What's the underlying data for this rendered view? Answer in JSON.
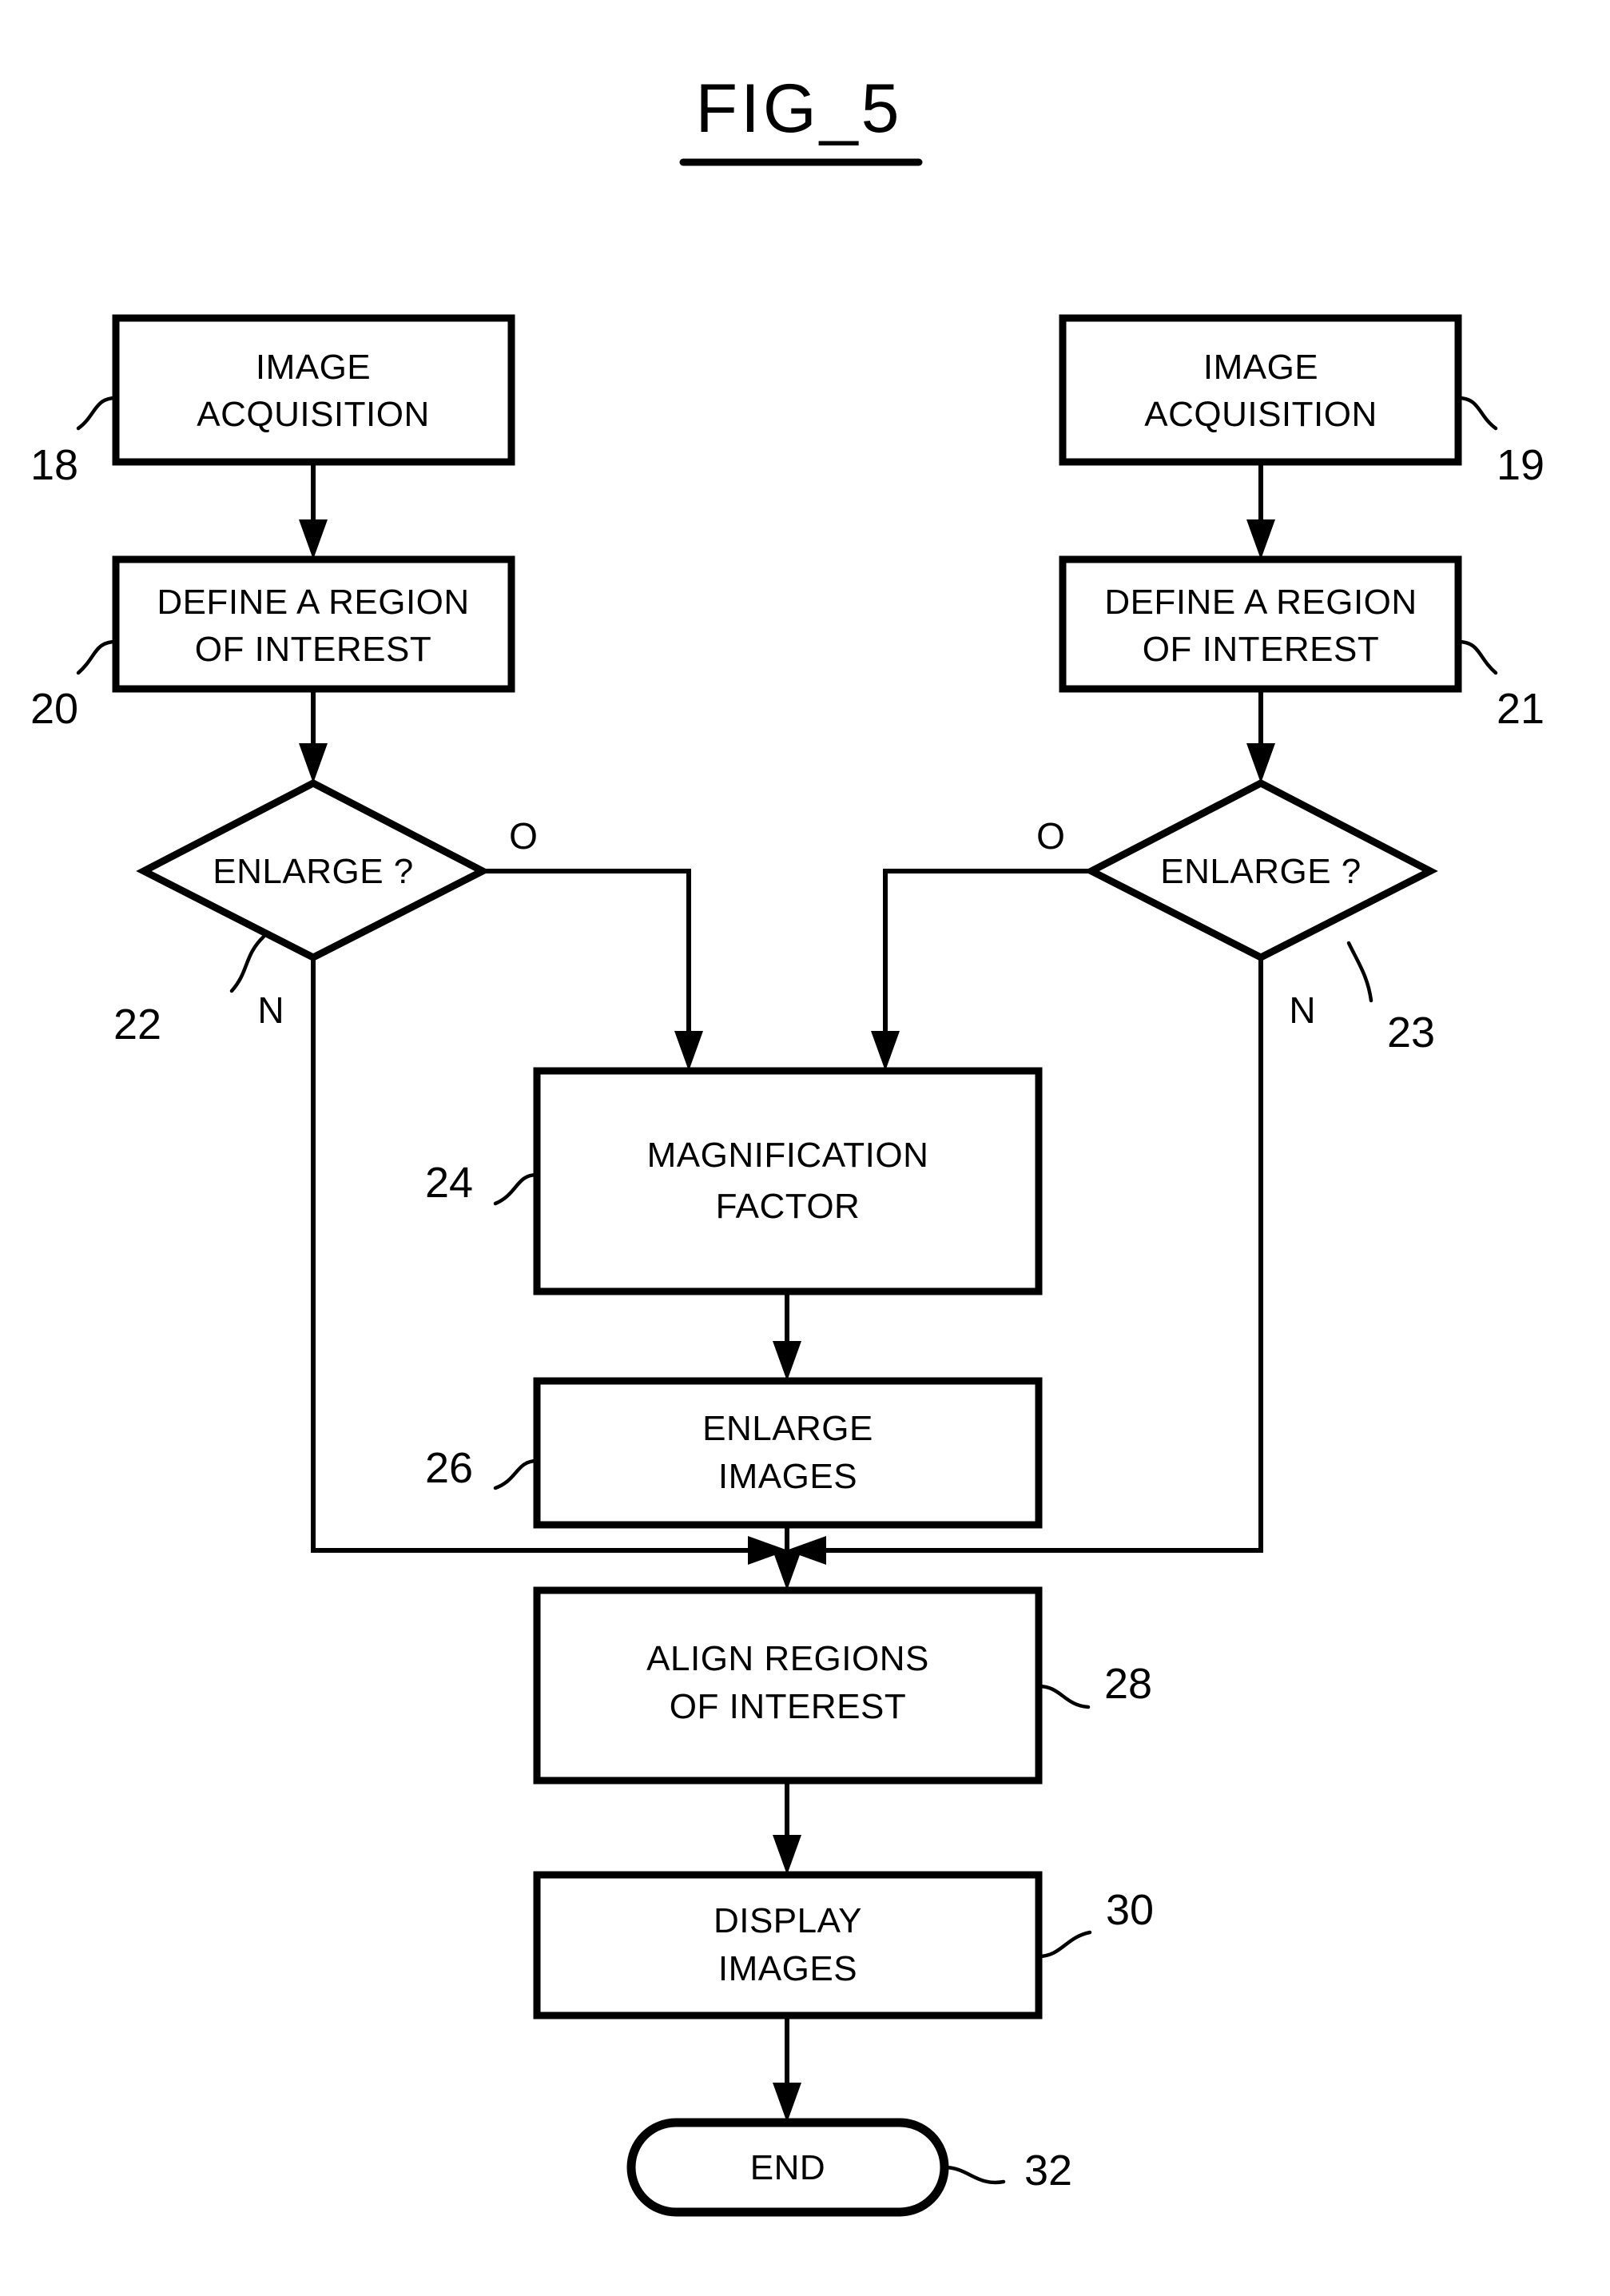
{
  "figure": {
    "title": "FIG_5",
    "type": "patent-flowchart"
  },
  "nodes": {
    "n18": {
      "ref": "18",
      "line1": "IMAGE",
      "line2": "ACQUISITION",
      "shape": "process"
    },
    "n19": {
      "ref": "19",
      "line1": "IMAGE",
      "line2": "ACQUISITION",
      "shape": "process"
    },
    "n20": {
      "ref": "20",
      "line1": "DEFINE A REGION",
      "line2": "OF INTEREST",
      "shape": "process"
    },
    "n21": {
      "ref": "21",
      "line1": "DEFINE A REGION",
      "line2": "OF INTEREST",
      "shape": "process"
    },
    "n22": {
      "ref": "22",
      "line1": "ENLARGE ?",
      "shape": "decision"
    },
    "n23": {
      "ref": "23",
      "line1": "ENLARGE ?",
      "shape": "decision"
    },
    "n24": {
      "ref": "24",
      "line1": "MAGNIFICATION",
      "line2": "FACTOR",
      "shape": "process"
    },
    "n26": {
      "ref": "26",
      "line1": "ENLARGE",
      "line2": "IMAGES",
      "shape": "process"
    },
    "n28": {
      "ref": "28",
      "line1": "ALIGN REGIONS",
      "line2": "OF INTEREST",
      "shape": "process"
    },
    "n30": {
      "ref": "30",
      "line1": "DISPLAY",
      "line2": "IMAGES",
      "shape": "process"
    },
    "n32": {
      "ref": "32",
      "line1": "END",
      "shape": "terminal"
    }
  },
  "branch_labels": {
    "left_yes": "O",
    "left_no": "N",
    "right_yes": "O",
    "right_no": "N"
  },
  "chart_data": {
    "type": "table",
    "title": "FIG_5",
    "nodes": [
      {
        "id": "18",
        "label": "IMAGE ACQUISITION",
        "shape": "process",
        "column": "left"
      },
      {
        "id": "20",
        "label": "DEFINE A REGION OF INTEREST",
        "shape": "process",
        "column": "left"
      },
      {
        "id": "22",
        "label": "ENLARGE ?",
        "shape": "decision",
        "column": "left"
      },
      {
        "id": "19",
        "label": "IMAGE ACQUISITION",
        "shape": "process",
        "column": "right"
      },
      {
        "id": "21",
        "label": "DEFINE A REGION OF INTEREST",
        "shape": "process",
        "column": "right"
      },
      {
        "id": "23",
        "label": "ENLARGE ?",
        "shape": "decision",
        "column": "right"
      },
      {
        "id": "24",
        "label": "MAGNIFICATION FACTOR",
        "shape": "process",
        "column": "center"
      },
      {
        "id": "26",
        "label": "ENLARGE IMAGES",
        "shape": "process",
        "column": "center"
      },
      {
        "id": "28",
        "label": "ALIGN REGIONS OF INTEREST",
        "shape": "process",
        "column": "center"
      },
      {
        "id": "30",
        "label": "DISPLAY IMAGES",
        "shape": "process",
        "column": "center"
      },
      {
        "id": "32",
        "label": "END",
        "shape": "terminal",
        "column": "center"
      }
    ],
    "edges": [
      {
        "from": "18",
        "to": "20",
        "label": ""
      },
      {
        "from": "20",
        "to": "22",
        "label": ""
      },
      {
        "from": "22",
        "to": "24",
        "label": "O"
      },
      {
        "from": "22",
        "to": "28",
        "label": "N"
      },
      {
        "from": "19",
        "to": "21",
        "label": ""
      },
      {
        "from": "21",
        "to": "23",
        "label": ""
      },
      {
        "from": "23",
        "to": "24",
        "label": "O"
      },
      {
        "from": "23",
        "to": "28",
        "label": "N"
      },
      {
        "from": "24",
        "to": "26",
        "label": ""
      },
      {
        "from": "26",
        "to": "28",
        "label": ""
      },
      {
        "from": "28",
        "to": "30",
        "label": ""
      },
      {
        "from": "30",
        "to": "32",
        "label": ""
      }
    ]
  }
}
